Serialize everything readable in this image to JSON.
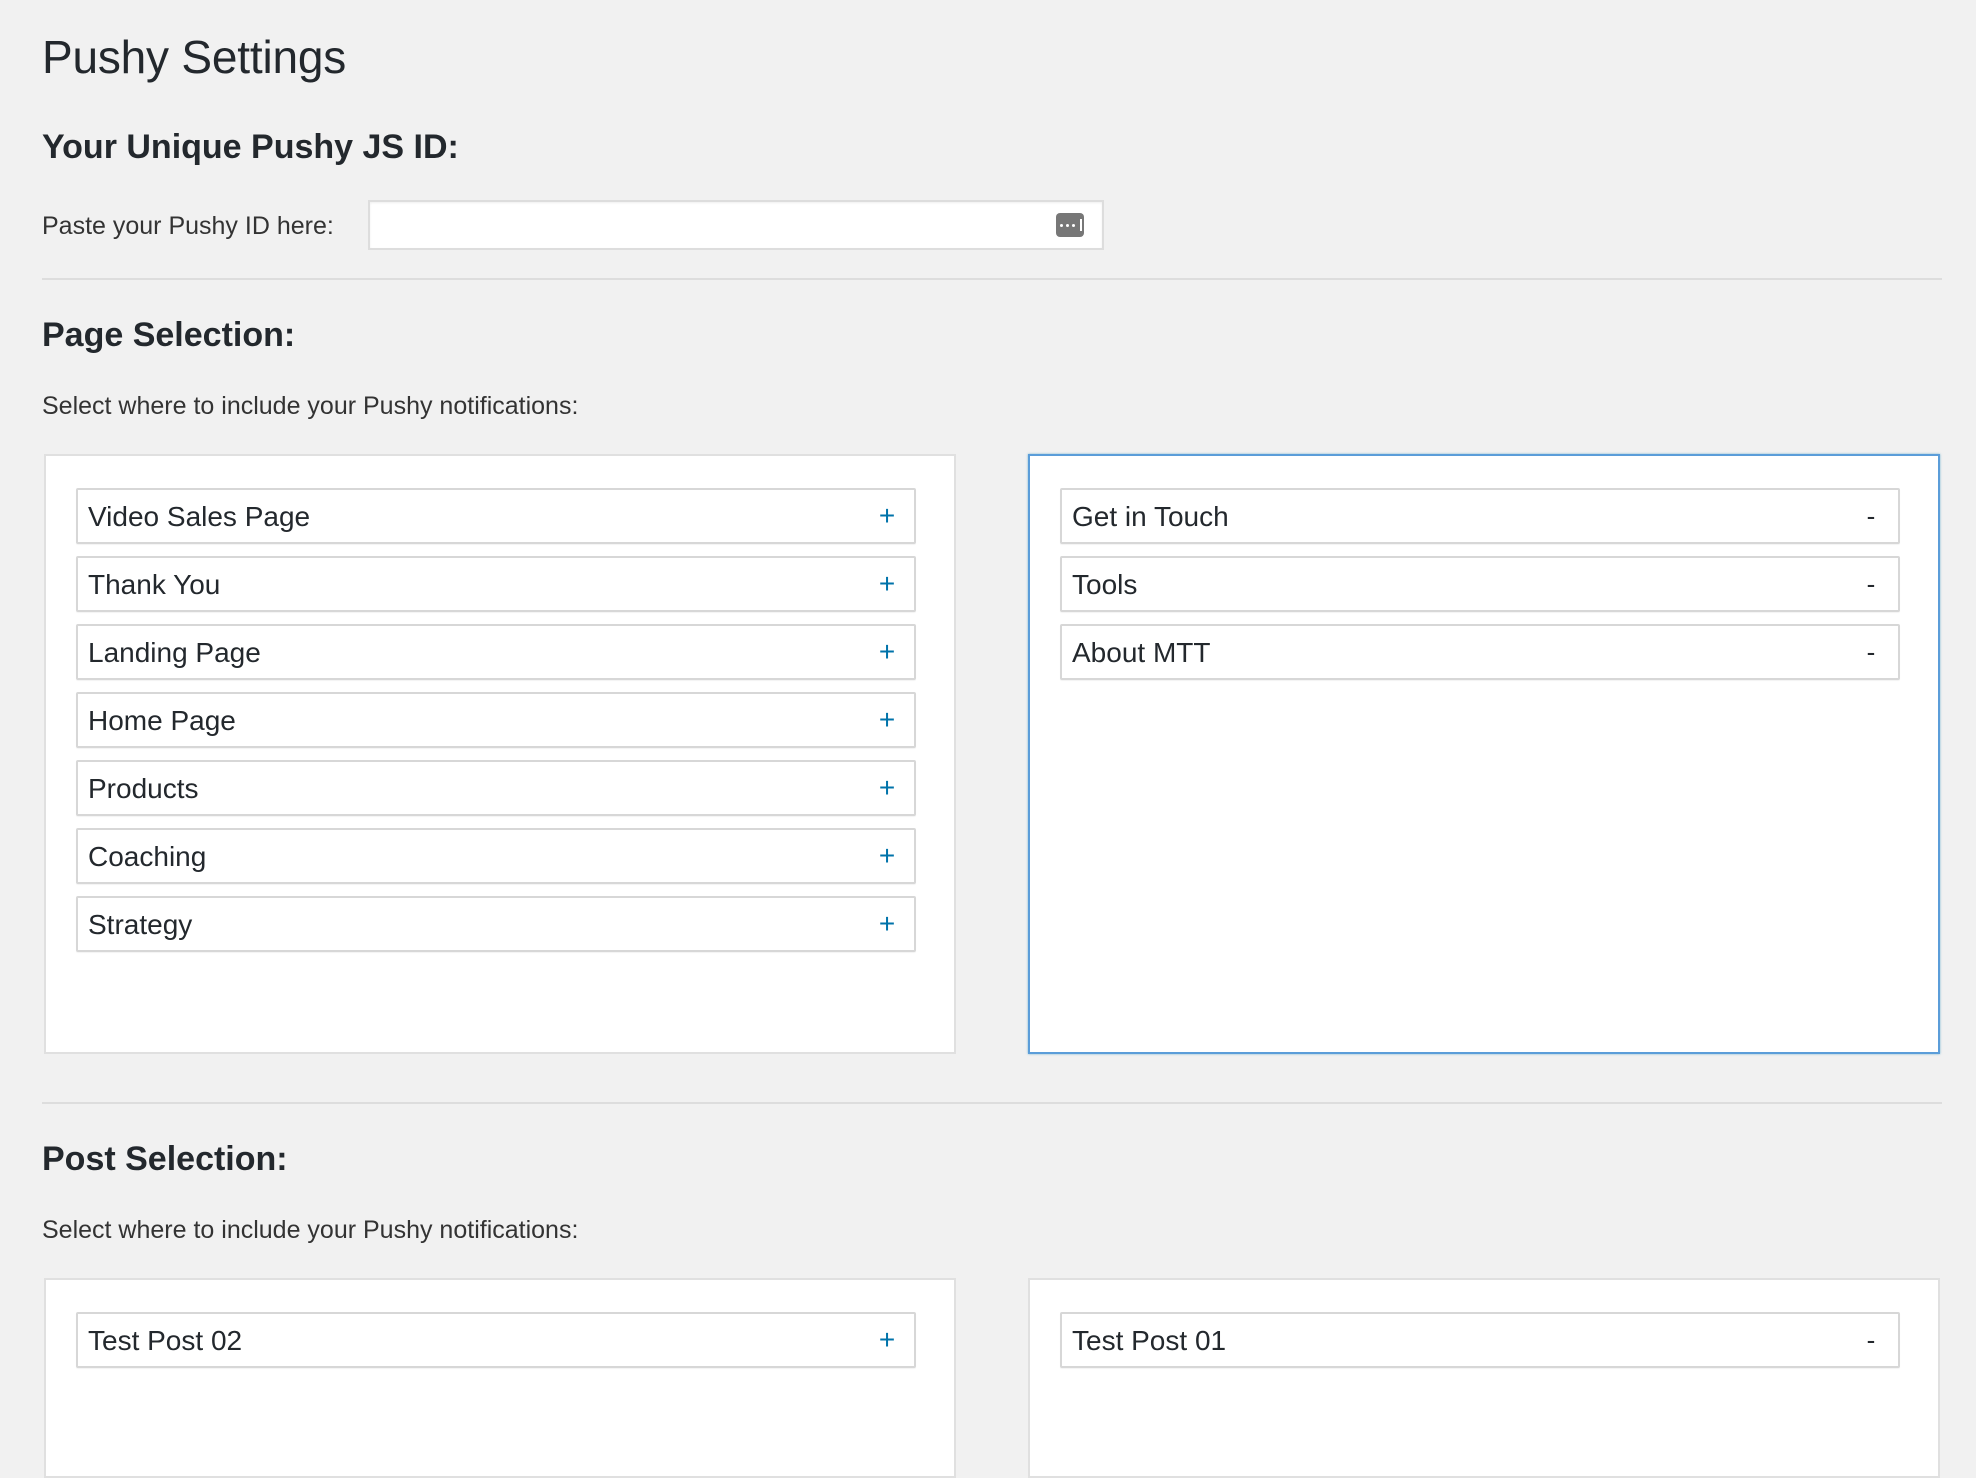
{
  "page_title": "Pushy Settings",
  "id_section": {
    "heading": "Your Unique Pushy JS ID:",
    "label": "Paste your Pushy ID here:",
    "value": "",
    "icon": "password-manager-icon"
  },
  "page_selection": {
    "heading": "Page Selection:",
    "description": "Select where to include your Pushy notifications:",
    "available": [
      {
        "label": "Video Sales Page",
        "action": "+"
      },
      {
        "label": "Thank You",
        "action": "+"
      },
      {
        "label": "Landing Page",
        "action": "+"
      },
      {
        "label": "Home Page",
        "action": "+"
      },
      {
        "label": "Products",
        "action": "+"
      },
      {
        "label": "Coaching",
        "action": "+"
      },
      {
        "label": "Strategy",
        "action": "+"
      }
    ],
    "selected": [
      {
        "label": "Get in Touch",
        "action": "-"
      },
      {
        "label": "Tools",
        "action": "-"
      },
      {
        "label": "About MTT",
        "action": "-"
      }
    ]
  },
  "post_selection": {
    "heading": "Post Selection:",
    "description": "Select where to include your Pushy notifications:",
    "available": [
      {
        "label": "Test Post 02",
        "action": "+"
      }
    ],
    "selected": [
      {
        "label": "Test Post 01",
        "action": "-"
      }
    ]
  },
  "colors": {
    "background": "#f1f1f1",
    "add_button": "#0073aa",
    "focus_border": "#5b9dd9",
    "text": "#23282d"
  }
}
